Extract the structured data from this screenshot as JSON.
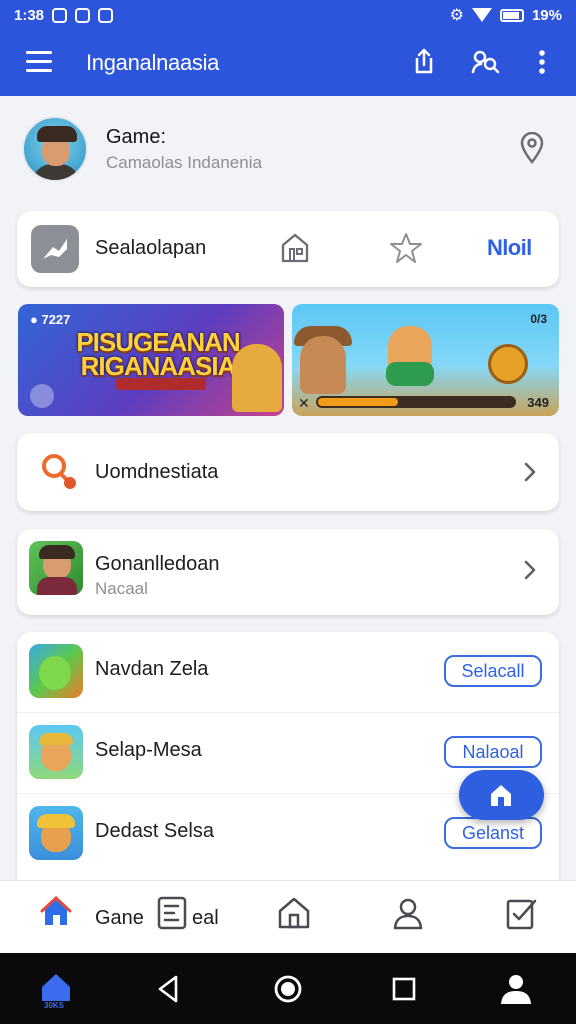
{
  "status_bar": {
    "time": "1:38",
    "battery": "19%"
  },
  "app_bar": {
    "title": "Inganalnaasia"
  },
  "profile": {
    "title": "Game:",
    "subtitle": "Camaolas Indanenia"
  },
  "quick_row": {
    "label": "Sealaolapan",
    "link": "Nloil"
  },
  "banner_1": {
    "coins": "7227",
    "title": "PISUGEANAN RIGANAASIA"
  },
  "banner_2": {
    "top": "0/3",
    "score": "349"
  },
  "row_1": {
    "label": "Uomdnestiata"
  },
  "game_row": {
    "title": "Gonanlledoan",
    "subtitle": "Nacaal"
  },
  "list": [
    {
      "label": "Navdan Zela",
      "button": "Selacall"
    },
    {
      "label": "Selap-Mesa",
      "button": "Nalaoal"
    },
    {
      "label": "Dedast Selsa",
      "button": "Gelanst"
    }
  ],
  "bottom_nav": {
    "label": "Gane",
    "label_2": "eal"
  },
  "system_nav": {
    "home_label": "30KS"
  },
  "colors": {
    "primary": "#2d55db",
    "accent": "#2e62e6"
  }
}
